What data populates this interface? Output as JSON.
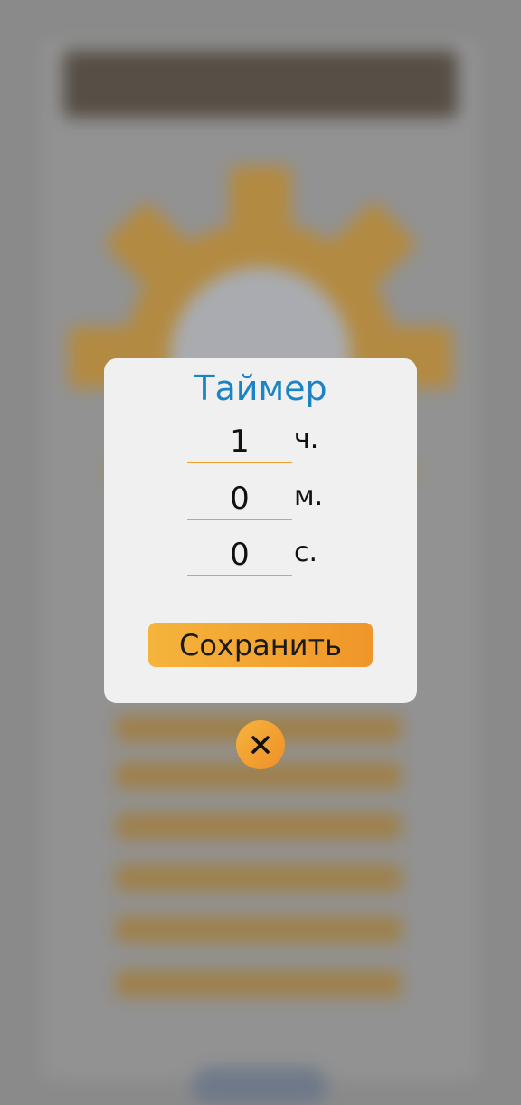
{
  "dialog": {
    "title": "Таймер",
    "fields": [
      {
        "value": "1",
        "unit": "ч."
      },
      {
        "value": "0",
        "unit": "м."
      },
      {
        "value": "0",
        "unit": "с."
      }
    ],
    "save_label": "Сохранить"
  },
  "icons": {
    "close": "close-icon"
  },
  "colors": {
    "accent": "#f0a030",
    "title": "#1b84c4",
    "dialog_bg": "#f0f0f0",
    "overlay": "#9a9a9a"
  }
}
